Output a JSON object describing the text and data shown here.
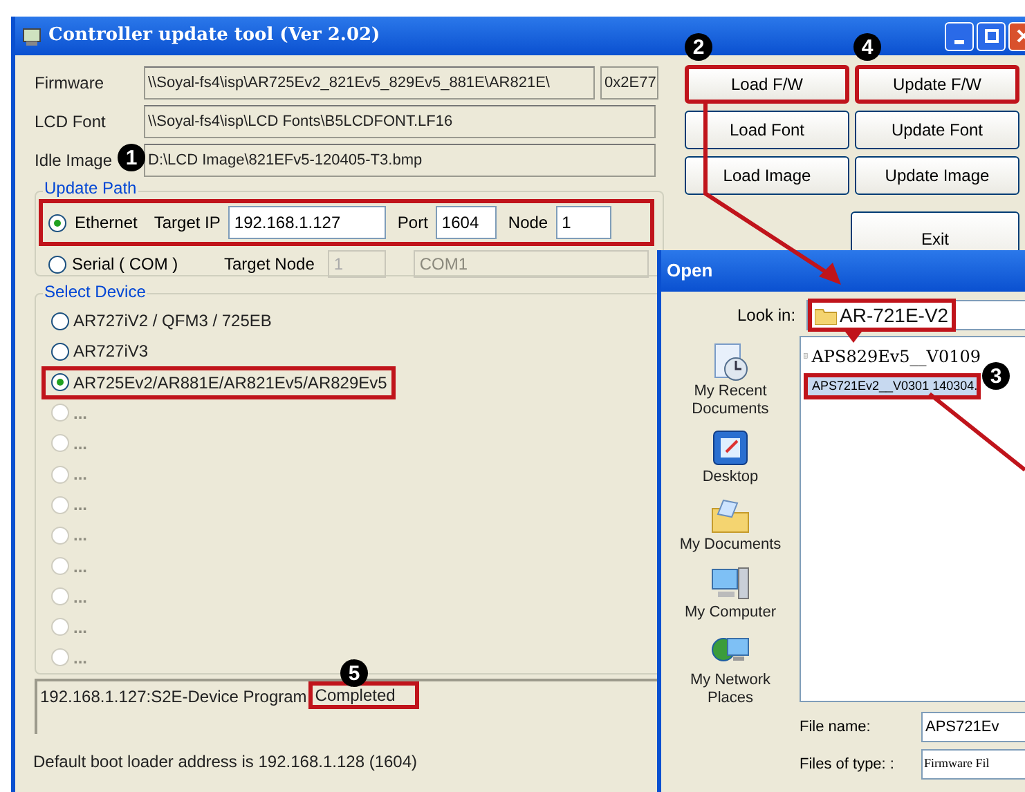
{
  "window": {
    "title": "Controller update tool  (Ver 2.02)"
  },
  "file_fields": [
    {
      "label": "Firmware",
      "value": "\\\\Soyal-fs4\\isp\\AR725Ev2_821Ev5_829Ev5_881E\\AR821E\\",
      "extra": "0x2E77"
    },
    {
      "label": "LCD Font",
      "value": "\\\\Soyal-fs4\\isp\\LCD Fonts\\B5LCDFONT.LF16"
    },
    {
      "label": "Idle Image",
      "value": "D:\\LCD Image\\821EFv5-120405-T3.bmp"
    }
  ],
  "buttons": [
    {
      "label": "Load F/W",
      "highlighted": true
    },
    {
      "label": "Update F/W",
      "highlighted": true
    },
    {
      "label": "Load Font",
      "highlighted": false
    },
    {
      "label": "Update Font",
      "highlighted": false
    },
    {
      "label": "Load Image",
      "highlighted": false
    },
    {
      "label": "Update Image",
      "highlighted": false
    }
  ],
  "exit_button": "Exit",
  "update_path": {
    "title": "Update Path",
    "ethernet": {
      "label": "Ethernet",
      "selected": true,
      "ip_label": "Target IP",
      "ip": "192.168.1.127",
      "port_label": "Port",
      "port": "1604",
      "node_label": "Node",
      "node": "1"
    },
    "serial": {
      "label": "Serial ( COM )",
      "selected": false,
      "node_label": "Target Node",
      "node": "1",
      "port": "COM1"
    }
  },
  "select_device": {
    "title": "Select Device",
    "items": [
      {
        "label": "AR727iV2 / QFM3 / 725EB",
        "selected": false,
        "disabled": false
      },
      {
        "label": "AR727iV3",
        "selected": false,
        "disabled": false
      },
      {
        "label": "AR725Ev2/AR881E/AR821Ev5/AR829Ev5",
        "selected": true,
        "disabled": false
      },
      {
        "label": "...",
        "selected": false,
        "disabled": true
      },
      {
        "label": "...",
        "selected": false,
        "disabled": true
      },
      {
        "label": "...",
        "selected": false,
        "disabled": true
      },
      {
        "label": "...",
        "selected": false,
        "disabled": true
      },
      {
        "label": "...",
        "selected": false,
        "disabled": true
      },
      {
        "label": "...",
        "selected": false,
        "disabled": true
      },
      {
        "label": "...",
        "selected": false,
        "disabled": true
      },
      {
        "label": "...",
        "selected": false,
        "disabled": true
      },
      {
        "label": "...",
        "selected": false,
        "disabled": true
      }
    ]
  },
  "status_text": "192.168.1.127:S2E-Device Program",
  "status_result": "Completed",
  "footer": "Default boot loader address is 192.168.1.128 (1604)",
  "open_dialog": {
    "title": "Open",
    "look_in_label": "Look in:",
    "look_in": "AR-721E-V2",
    "places": [
      "My Recent Documents",
      "Desktop",
      "My Documents",
      "My Computer",
      "My Network Places"
    ],
    "files": [
      {
        "name": "APS829Ev5__V0109",
        "selected": false
      },
      {
        "name": "APS721Ev2__V0301 140304.",
        "selected": true
      }
    ],
    "file_name_label": "File name:",
    "file_name": "APS721Ev",
    "file_type_label": "Files of type: :",
    "file_type": "Firmware Fil"
  },
  "badges": [
    "1",
    "2",
    "3",
    "4",
    "5"
  ]
}
